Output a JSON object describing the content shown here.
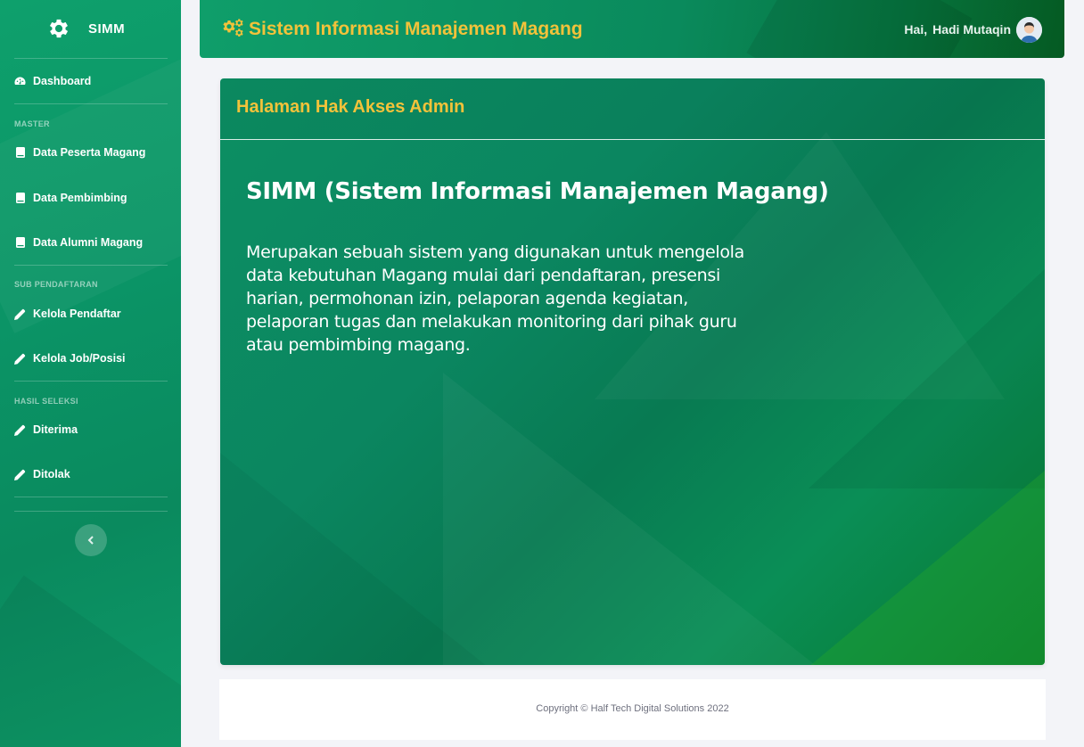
{
  "sidebar": {
    "brand": "SIMM",
    "dashboard": "Dashboard",
    "heading_master": "MASTER",
    "master_items": [
      "Data Peserta Magang",
      "Data Pembimbing",
      "Data Alumni Magang"
    ],
    "heading_sub": "SUB PENDAFTARAN",
    "sub_items": [
      "Kelola Pendaftar",
      "Kelola Job/Posisi"
    ],
    "heading_hasil": "HASIL SELEKSI",
    "hasil_items": [
      "Diterima",
      "Ditolak"
    ],
    "toggle_icon": "chevron-left-icon"
  },
  "topbar": {
    "title": "Sistem Informasi Manajemen Magang",
    "greeting": "Hai,",
    "user_name": "Hadi Mutaqin"
  },
  "card": {
    "header_title": "Halaman Hak Akses Admin",
    "hero_title": "SIMM (Sistem Informasi Manajemen Magang)",
    "hero_text": "Merupakan sebuah sistem yang digunakan untuk mengelola data kebutuhan Magang mulai dari pendaftaran, presensi harian, permohonan izin, pelaporan agenda kegiatan, pelaporan tugas dan melakukan monitoring dari pihak guru atau pembimbing magang."
  },
  "footer": {
    "copyright": "Copyright © Half Tech Digital Solutions 2022"
  },
  "colors": {
    "sidebar_green": "#0b9466",
    "accent_gold": "#f2c23a",
    "page_bg": "#f3f4f8"
  }
}
